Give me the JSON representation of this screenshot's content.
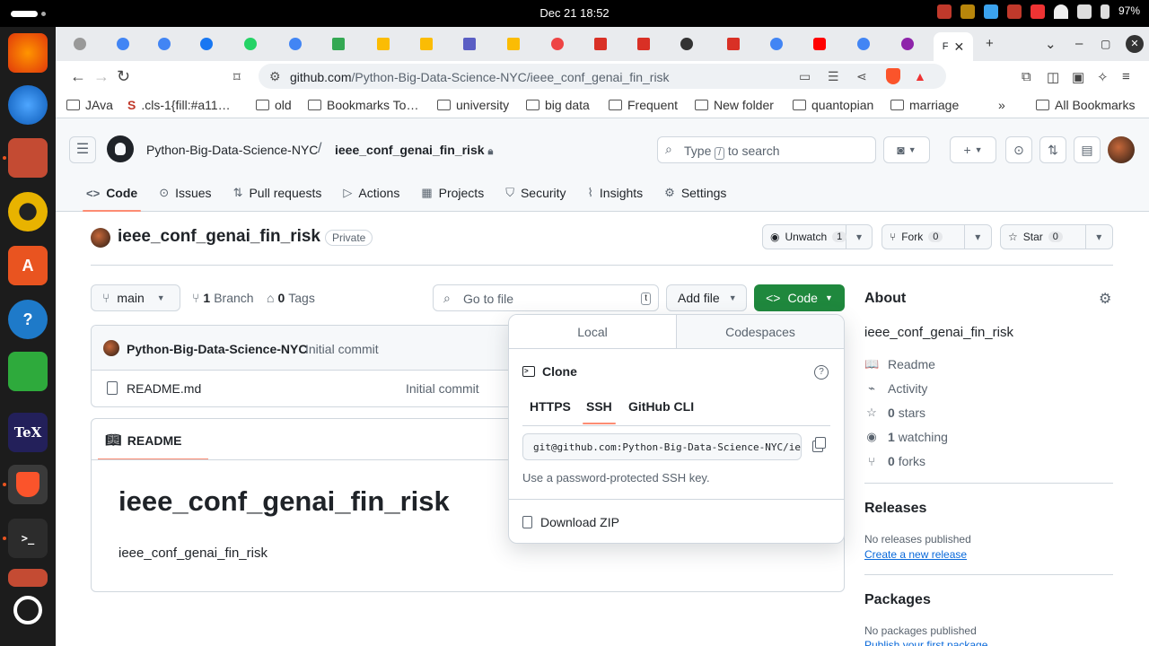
{
  "os": {
    "clock": "Dec 21  18:52",
    "battery": "97%"
  },
  "browser": {
    "active_tab_letter": "F",
    "url_host": "github.com",
    "url_path": "/Python-Big-Data-Science-NYC/ieee_conf_genai_fin_risk",
    "bookmarks": [
      {
        "label": "JAva",
        "icon": "folder"
      },
      {
        "label": ".cls-1{fill:#a11…",
        "icon": "site"
      },
      {
        "label": "old",
        "icon": "folder"
      },
      {
        "label": "Bookmarks To…",
        "icon": "folder"
      },
      {
        "label": "university",
        "icon": "folder"
      },
      {
        "label": "big data",
        "icon": "folder"
      },
      {
        "label": "Frequent",
        "icon": "folder"
      },
      {
        "label": "New folder",
        "icon": "folder"
      },
      {
        "label": "quantopian",
        "icon": "folder"
      },
      {
        "label": "marriage",
        "icon": "folder"
      }
    ],
    "more_bookmarks": "»",
    "all_bookmarks": "All Bookmarks"
  },
  "github": {
    "owner": "Python-Big-Data-Science-NYC",
    "sep": "/",
    "repo": "ieee_conf_genai_fin_risk",
    "search_pre": "Type",
    "search_key": "/",
    "search_post": "to search",
    "nav": [
      {
        "label": "Code",
        "icon": "<>",
        "selected": true
      },
      {
        "label": "Issues",
        "icon": "⊙"
      },
      {
        "label": "Pull requests",
        "icon": "⇅"
      },
      {
        "label": "Actions",
        "icon": "▷"
      },
      {
        "label": "Projects",
        "icon": "▦"
      },
      {
        "label": "Security",
        "icon": "⛉"
      },
      {
        "label": "Insights",
        "icon": "⌇"
      },
      {
        "label": "Settings",
        "icon": "⚙"
      }
    ],
    "repo_title": "ieee_conf_genai_fin_risk",
    "visibility": "Private",
    "unwatch": {
      "label": "Unwatch",
      "count": "1"
    },
    "fork": {
      "label": "Fork",
      "count": "0"
    },
    "star": {
      "label": "Star",
      "count": "0"
    },
    "branch": "main",
    "branch_count": "1",
    "branch_label": "Branch",
    "tag_count": "0",
    "tag_label": "Tags",
    "goto_placeholder": "Go to file",
    "goto_key": "t",
    "add_file": "Add file",
    "code_btn": "Code",
    "commit_author": "Python-Big-Data-Science-NYC",
    "commit_msg": "Initial commit",
    "files": [
      {
        "name": "README.md",
        "commit": "Initial commit"
      }
    ],
    "readme_tab": "README",
    "readme_h1": "ieee_conf_genai_fin_risk",
    "readme_p": "ieee_conf_genai_fin_risk"
  },
  "clone": {
    "tab_local": "Local",
    "tab_codespaces": "Codespaces",
    "title": "Clone",
    "protocols": [
      "HTTPS",
      "SSH",
      "GitHub CLI"
    ],
    "selected_protocol": "SSH",
    "url": "git@github.com:Python-Big-Data-Science-NYC/ieee_conf_genai_fin_risk.git",
    "hint": "Use a password-protected SSH key.",
    "download": "Download ZIP"
  },
  "sidebar": {
    "about": "About",
    "description": "ieee_conf_genai_fin_risk",
    "items": [
      {
        "icon": "📖",
        "count": "",
        "label": "Readme"
      },
      {
        "icon": "⌁",
        "count": "",
        "label": "Activity"
      },
      {
        "icon": "☆",
        "count": "0",
        "label": "stars"
      },
      {
        "icon": "◉",
        "count": "1",
        "label": "watching"
      },
      {
        "icon": "⑂",
        "count": "0",
        "label": "forks"
      }
    ],
    "releases_h": "Releases",
    "releases_none": "No releases published",
    "releases_link": "Create a new release",
    "packages_h": "Packages",
    "packages_none": "No packages published",
    "packages_link": "Publish your first package"
  }
}
